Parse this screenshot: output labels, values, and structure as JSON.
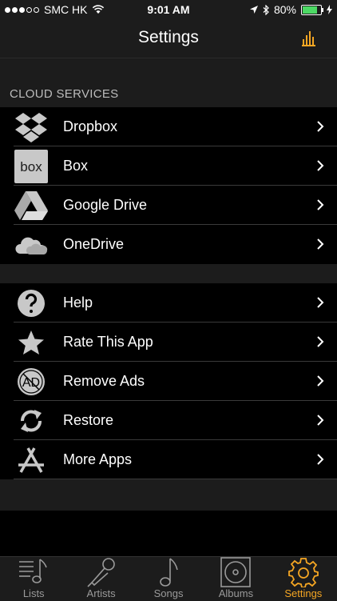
{
  "status_bar": {
    "carrier": "SMC HK",
    "time": "9:01 AM",
    "battery_percent": "80%",
    "battery_level": 0.8
  },
  "nav": {
    "title": "Settings"
  },
  "sections": {
    "cloud_header": "CLOUD SERVICES",
    "cloud_items": [
      {
        "label": "Dropbox",
        "icon": "dropbox-icon"
      },
      {
        "label": "Box",
        "icon": "box-icon",
        "icon_text": "box"
      },
      {
        "label": "Google Drive",
        "icon": "google-drive-icon"
      },
      {
        "label": "OneDrive",
        "icon": "onedrive-icon"
      }
    ],
    "misc_items": [
      {
        "label": "Help",
        "icon": "help-icon"
      },
      {
        "label": "Rate This App",
        "icon": "star-icon"
      },
      {
        "label": "Remove Ads",
        "icon": "remove-ads-icon",
        "icon_text": "AD"
      },
      {
        "label": "Restore",
        "icon": "restore-icon"
      },
      {
        "label": "More Apps",
        "icon": "app-store-icon"
      }
    ]
  },
  "tab_bar": {
    "tabs": [
      {
        "label": "Lists",
        "icon": "lists-icon"
      },
      {
        "label": "Artists",
        "icon": "microphone-icon"
      },
      {
        "label": "Songs",
        "icon": "music-note-icon"
      },
      {
        "label": "Albums",
        "icon": "album-icon"
      },
      {
        "label": "Settings",
        "icon": "gear-icon"
      }
    ],
    "active_tab": "Settings"
  },
  "colors": {
    "accent": "#f5a623",
    "background": "#1c1c1c",
    "row_background": "#000000",
    "icon_gray": "#c8c8c8",
    "separator": "#3a3a3a"
  }
}
